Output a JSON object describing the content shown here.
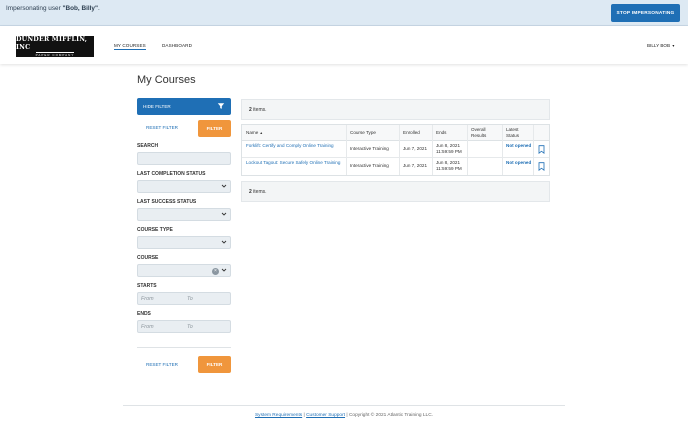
{
  "impersonation": {
    "prefix": "Impersonating user ",
    "user": "\"Bob, Billy\"",
    "suffix": ".",
    "stop_label": "STOP IMPERSONATING"
  },
  "header": {
    "logo_main": "DUNDER MIFFLIN, INC",
    "logo_sub": "PAPER COMPANY",
    "nav": [
      "MY COURSES",
      "DASHBOARD"
    ],
    "user_name": "BILLY BOB",
    "user_caret": "▾"
  },
  "page": {
    "title": "My Courses"
  },
  "filters": {
    "hide_filter_label": "HIDE FILTER",
    "reset_label": "RESET FILTER",
    "filter_label": "FILTER",
    "search_label": "SEARCH",
    "search_value": "",
    "last_completion_label": "LAST COMPLETION STATUS",
    "last_success_label": "LAST SUCCESS STATUS",
    "course_type_label": "COURSE TYPE",
    "course_label": "COURSE",
    "starts_label": "STARTS",
    "ends_label": "ENDS",
    "from_placeholder": "From",
    "to_placeholder": "To",
    "clear_glyph": "×"
  },
  "results": {
    "count": "2",
    "count_suffix": " items.",
    "columns": [
      "Name",
      "Course Type",
      "Enrolled",
      "Ends",
      "Overall Results",
      "Latest Status"
    ],
    "sort_indicator": "▲",
    "rows": [
      {
        "name": "Forklift: Certify and Comply Online Training",
        "type": "Interactive Training",
        "enrolled": "Jun 7, 2021",
        "ends": "Jun 8, 2021 11:59:59 PM",
        "overall": "",
        "status": "Not opened"
      },
      {
        "name": "Lockout Tagout: Secure Safely Online Training",
        "type": "Interactive Training",
        "enrolled": "Jun 7, 2021",
        "ends": "Jun 8, 2021 11:59:59 PM",
        "overall": "",
        "status": "Not opened"
      }
    ]
  },
  "footer": {
    "system_requirements": "System Requirements",
    "sep": " | ",
    "customer_support": "Customer Support",
    "copyright": " | Copyright © 2021 Atlantic Training LLC."
  },
  "colors": {
    "accent": "#1f6fb5",
    "filter_button": "#f0963c",
    "banner": "#dde9f3"
  },
  "icons": [
    "filter-icon",
    "chevron-down-icon",
    "clear-icon",
    "bookmark-icon",
    "caret-down-icon",
    "sort-up-icon"
  ]
}
